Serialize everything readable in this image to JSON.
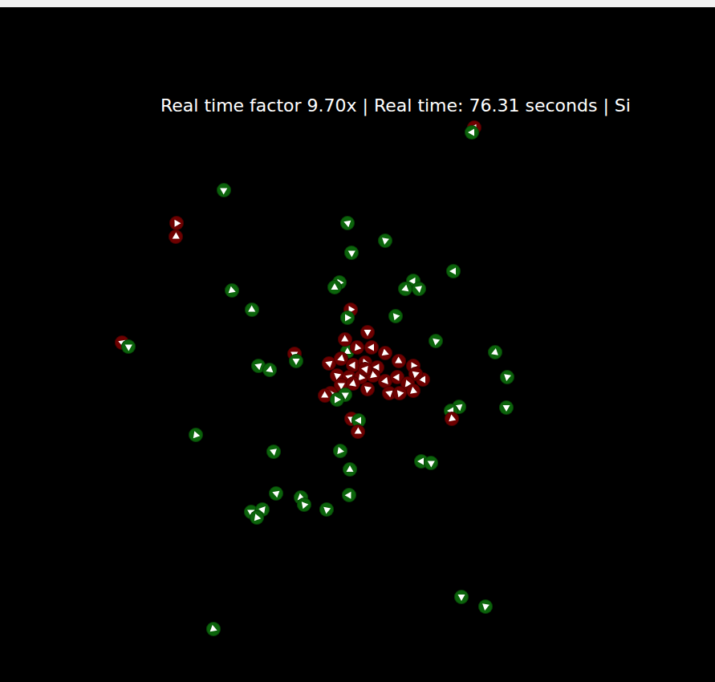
{
  "status_bar": {
    "text": "Real time factor 9.70x | Real time: 76.31 seconds | Si"
  },
  "agents": [
    {
      "color": "#6e0000",
      "heading": 300
    },
    {
      "color": "#0b640b",
      "heading": 180
    },
    {
      "color": "#0b640b",
      "heading": 330
    },
    {
      "color": "#6e0000",
      "heading": 240
    },
    {
      "color": "#6e0000",
      "heading": 150
    },
    {
      "color": "#0b640b",
      "heading": 200
    },
    {
      "color": "#0b640b",
      "heading": 100
    },
    {
      "color": "#0b640b",
      "heading": 210
    },
    {
      "color": "#0b640b",
      "heading": 180
    },
    {
      "color": "#0b640b",
      "heading": 20
    },
    {
      "color": "#0b640b",
      "heading": 240
    },
    {
      "color": "#0b640b",
      "heading": 270
    },
    {
      "color": "#0b640b",
      "heading": 300
    },
    {
      "color": "#0b640b",
      "heading": 160
    },
    {
      "color": "#0b640b",
      "heading": 80
    },
    {
      "color": "#0b640b",
      "heading": 30
    },
    {
      "color": "#6e0000",
      "heading": 120
    },
    {
      "color": "#0b640b",
      "heading": 0
    },
    {
      "color": "#0b640b",
      "heading": 230
    },
    {
      "color": "#6e0000",
      "heading": 200
    },
    {
      "color": "#0b640b",
      "heading": 210
    },
    {
      "color": "#0b640b",
      "heading": 220
    },
    {
      "color": "#0b640b",
      "heading": 280
    },
    {
      "color": "#6e0000",
      "heading": 330
    },
    {
      "color": "#0b640b",
      "heading": 90
    },
    {
      "color": "#0b640b",
      "heading": 200
    },
    {
      "color": "#0b640b",
      "heading": 160
    },
    {
      "color": "#0b640b",
      "heading": 100
    },
    {
      "color": "#0b640b",
      "heading": 270
    },
    {
      "color": "#6e0000",
      "heading": 90
    },
    {
      "color": "#6e0000",
      "heading": 30
    },
    {
      "color": "#6e0000",
      "heading": 250
    },
    {
      "color": "#6e0000",
      "heading": 180
    },
    {
      "color": "#6e0000",
      "heading": 20
    },
    {
      "color": "#6e0000",
      "heading": 30
    },
    {
      "color": "#6e0000",
      "heading": 200
    },
    {
      "color": "#6e0000",
      "heading": 160
    },
    {
      "color": "#6e0000",
      "heading": 300
    },
    {
      "color": "#6e0000",
      "heading": 10
    },
    {
      "color": "#6e0000",
      "heading": 60
    },
    {
      "color": "#6e0000",
      "heading": 120
    },
    {
      "color": "#6e0000",
      "heading": 180
    },
    {
      "color": "#6e0000",
      "heading": 340
    },
    {
      "color": "#6e0000",
      "heading": 220
    },
    {
      "color": "#6e0000",
      "heading": 200
    },
    {
      "color": "#6e0000",
      "heading": 250
    },
    {
      "color": "#6e0000",
      "heading": 140
    },
    {
      "color": "#6e0000",
      "heading": 170
    },
    {
      "color": "#6e0000",
      "heading": 300
    },
    {
      "color": "#6e0000",
      "heading": 250
    },
    {
      "color": "#6e0000",
      "heading": 210
    },
    {
      "color": "#6e0000",
      "heading": 280
    },
    {
      "color": "#6e0000",
      "heading": 100
    },
    {
      "color": "#6e0000",
      "heading": 240
    },
    {
      "color": "#6e0000",
      "heading": 200
    },
    {
      "color": "#6e0000",
      "heading": 230
    },
    {
      "color": "#6e0000",
      "heading": 260
    },
    {
      "color": "#6e0000",
      "heading": 30
    },
    {
      "color": "#6e0000",
      "heading": 190
    },
    {
      "color": "#0b640b",
      "heading": 210
    },
    {
      "color": "#0b640b",
      "heading": 0
    },
    {
      "color": "#0b640b",
      "heading": 200
    },
    {
      "color": "#0b640b",
      "heading": 180
    },
    {
      "color": "#6e0000",
      "heading": 140
    },
    {
      "color": "#0b640b",
      "heading": 90
    },
    {
      "color": "#6e0000",
      "heading": 330
    },
    {
      "color": "#0b640b",
      "heading": 180
    },
    {
      "color": "#6e0000",
      "heading": 150
    },
    {
      "color": "#0b640b",
      "heading": 250
    },
    {
      "color": "#0b640b",
      "heading": 80
    },
    {
      "color": "#0b640b",
      "heading": 10
    },
    {
      "color": "#0b640b",
      "heading": 270
    },
    {
      "color": "#0b640b",
      "heading": 180
    },
    {
      "color": "#0b640b",
      "heading": 210
    },
    {
      "color": "#0b640b",
      "heading": 200
    },
    {
      "color": "#0b640b",
      "heading": 20
    },
    {
      "color": "#0b640b",
      "heading": 230
    },
    {
      "color": "#0b640b",
      "heading": 300
    },
    {
      "color": "#0b640b",
      "heading": 220
    },
    {
      "color": "#0b640b",
      "heading": 330
    },
    {
      "color": "#0b640b",
      "heading": 190
    },
    {
      "color": "#0b640b",
      "heading": 250
    },
    {
      "color": "#0b640b",
      "heading": 90
    },
    {
      "color": "#0b640b",
      "heading": 100
    },
    {
      "color": "#0b640b",
      "heading": 20
    }
  ]
}
